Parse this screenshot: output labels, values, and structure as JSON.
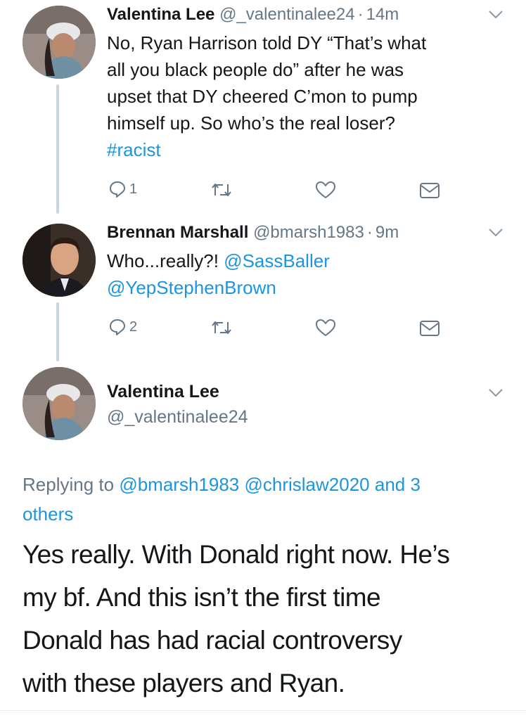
{
  "tweet1": {
    "name": "Valentina Lee",
    "handle": "@_valentinalee24",
    "sep": "·",
    "time": "14m",
    "line1": "No, Ryan Harrison told DY “That’s what",
    "line2": "all you black people do” after he was",
    "line3": "upset that DY cheered C’mon to pump",
    "line4": "himself up. So who’s the real loser?",
    "hashtag": "#racist",
    "reply_count": "1",
    "retweet_count": "",
    "like_count": ""
  },
  "tweet2": {
    "name": "Brennan Marshall",
    "handle": "@bmarsh1983",
    "sep": "·",
    "time": "9m",
    "text": "Who...really?!",
    "mention1": "@SassBaller",
    "mention2": "@YepStephenBrown",
    "reply_count": "2"
  },
  "main": {
    "name": "Valentina Lee",
    "handle": "@_valentinalee24",
    "replying_prefix": "Replying to",
    "reply_to_1": "@bmarsh1983",
    "reply_to_2": "@chrislaw2020",
    "reply_and": "and 3",
    "reply_others": "others",
    "line1": "Yes really. With Donald right now. He’s",
    "line2": "my bf. And this isn’t the first time",
    "line3": "Donald has had racial controversy",
    "line4": "with these players and Ryan."
  },
  "colors": {
    "link": "#1b95e0",
    "muted": "#657786",
    "text": "#14171a",
    "thread_line": "#ccd6dd"
  },
  "icons": [
    "chevron-down-icon",
    "reply-icon",
    "retweet-icon",
    "like-icon",
    "direct-message-icon"
  ]
}
